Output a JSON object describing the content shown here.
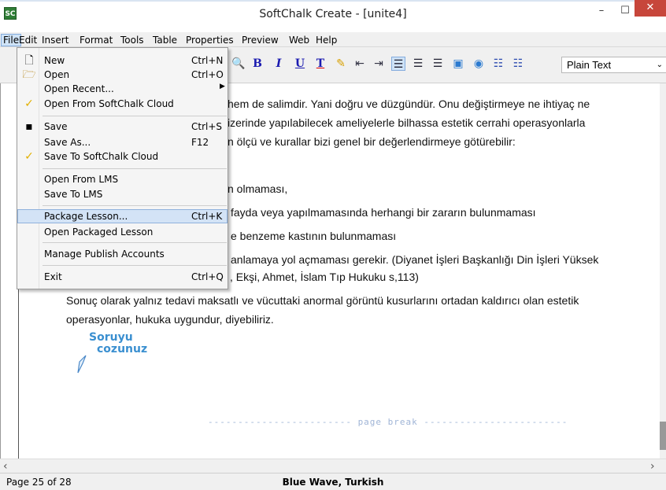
{
  "window": {
    "app_icon": "SC",
    "title": "SoftChalk Create - [unite4]",
    "minimize": "–",
    "maximize": "☐",
    "close": "✕"
  },
  "menubar": {
    "items": [
      "File",
      "Edit",
      "Insert",
      "Format",
      "Tools",
      "Table",
      "Properties",
      "Preview",
      "Web",
      "Help"
    ],
    "active": "File"
  },
  "toolbar": {
    "bold": "B",
    "italic": "I",
    "underline": "U",
    "text_color": "T",
    "style_select": "Plain Text"
  },
  "file_menu": {
    "items": [
      {
        "label": "New",
        "shortcut": "Ctrl+N",
        "icon": "new-document-icon"
      },
      {
        "label": "Open",
        "shortcut": "Ctrl+O",
        "icon": "open-folder-icon"
      },
      {
        "label": "Open Recent...",
        "shortcut": "",
        "icon": "",
        "submenu": true
      },
      {
        "label": "Open From SoftChalk Cloud",
        "shortcut": "",
        "icon": "cloud-check-icon"
      },
      {
        "label": "Save",
        "shortcut": "Ctrl+S",
        "icon": "save-disk-icon"
      },
      {
        "label": "Save As...",
        "shortcut": "F12",
        "icon": ""
      },
      {
        "label": "Save To SoftChalk Cloud",
        "shortcut": "",
        "icon": "cloud-check-icon"
      },
      {
        "label": "Open From LMS",
        "shortcut": "",
        "icon": ""
      },
      {
        "label": "Save To LMS",
        "shortcut": "",
        "icon": ""
      },
      {
        "label": "Package Lesson...",
        "shortcut": "Ctrl+K",
        "icon": "",
        "highlighted": true
      },
      {
        "label": "Open Packaged Lesson",
        "shortcut": "",
        "icon": ""
      },
      {
        "label": "Manage Publish Accounts",
        "shortcut": "",
        "icon": ""
      },
      {
        "label": "Exit",
        "shortcut": "Ctrl+Q",
        "icon": ""
      }
    ]
  },
  "document": {
    "lines": [
      "hem de salimdir. Yani doğru ve düzgündür. Onu değiştirmeye ne ihtiyaç ne",
      "izerinde yapılabilecek ameliyelerle bilhassa estetik cerrahi operasyonlarla",
      "n ölçü ve kurallar bizi genel bir değerlendirmeye götürebilir:",
      "n olmaması,",
      "fayda veya yapılmamasında herhangi bir zararın bulunmaması",
      "e benzeme kastının bulunmaması",
      "anlamaya yol açmaması gerekir. (Diyanet İşleri Başkanlığı Din İşleri Yüksek",
      ", Ekşi, Ahmet, İslam Tıp Hukuku s,113)",
      "Sonuç olarak yalnız tedavi maksatlı ve vücuttaki anormal görüntü kusurlarını ortadan kaldırıcı olan estetik",
      "operasyonlar, hukuka uygundur, diyebiliriz."
    ],
    "soruyu_line1": "Soruyu",
    "soruyu_line2": "cozunuz",
    "page_break": "------------------------ page break ------------------------"
  },
  "statusbar": {
    "page": "Page 25 of 28",
    "theme": "Blue Wave, Turkish"
  }
}
